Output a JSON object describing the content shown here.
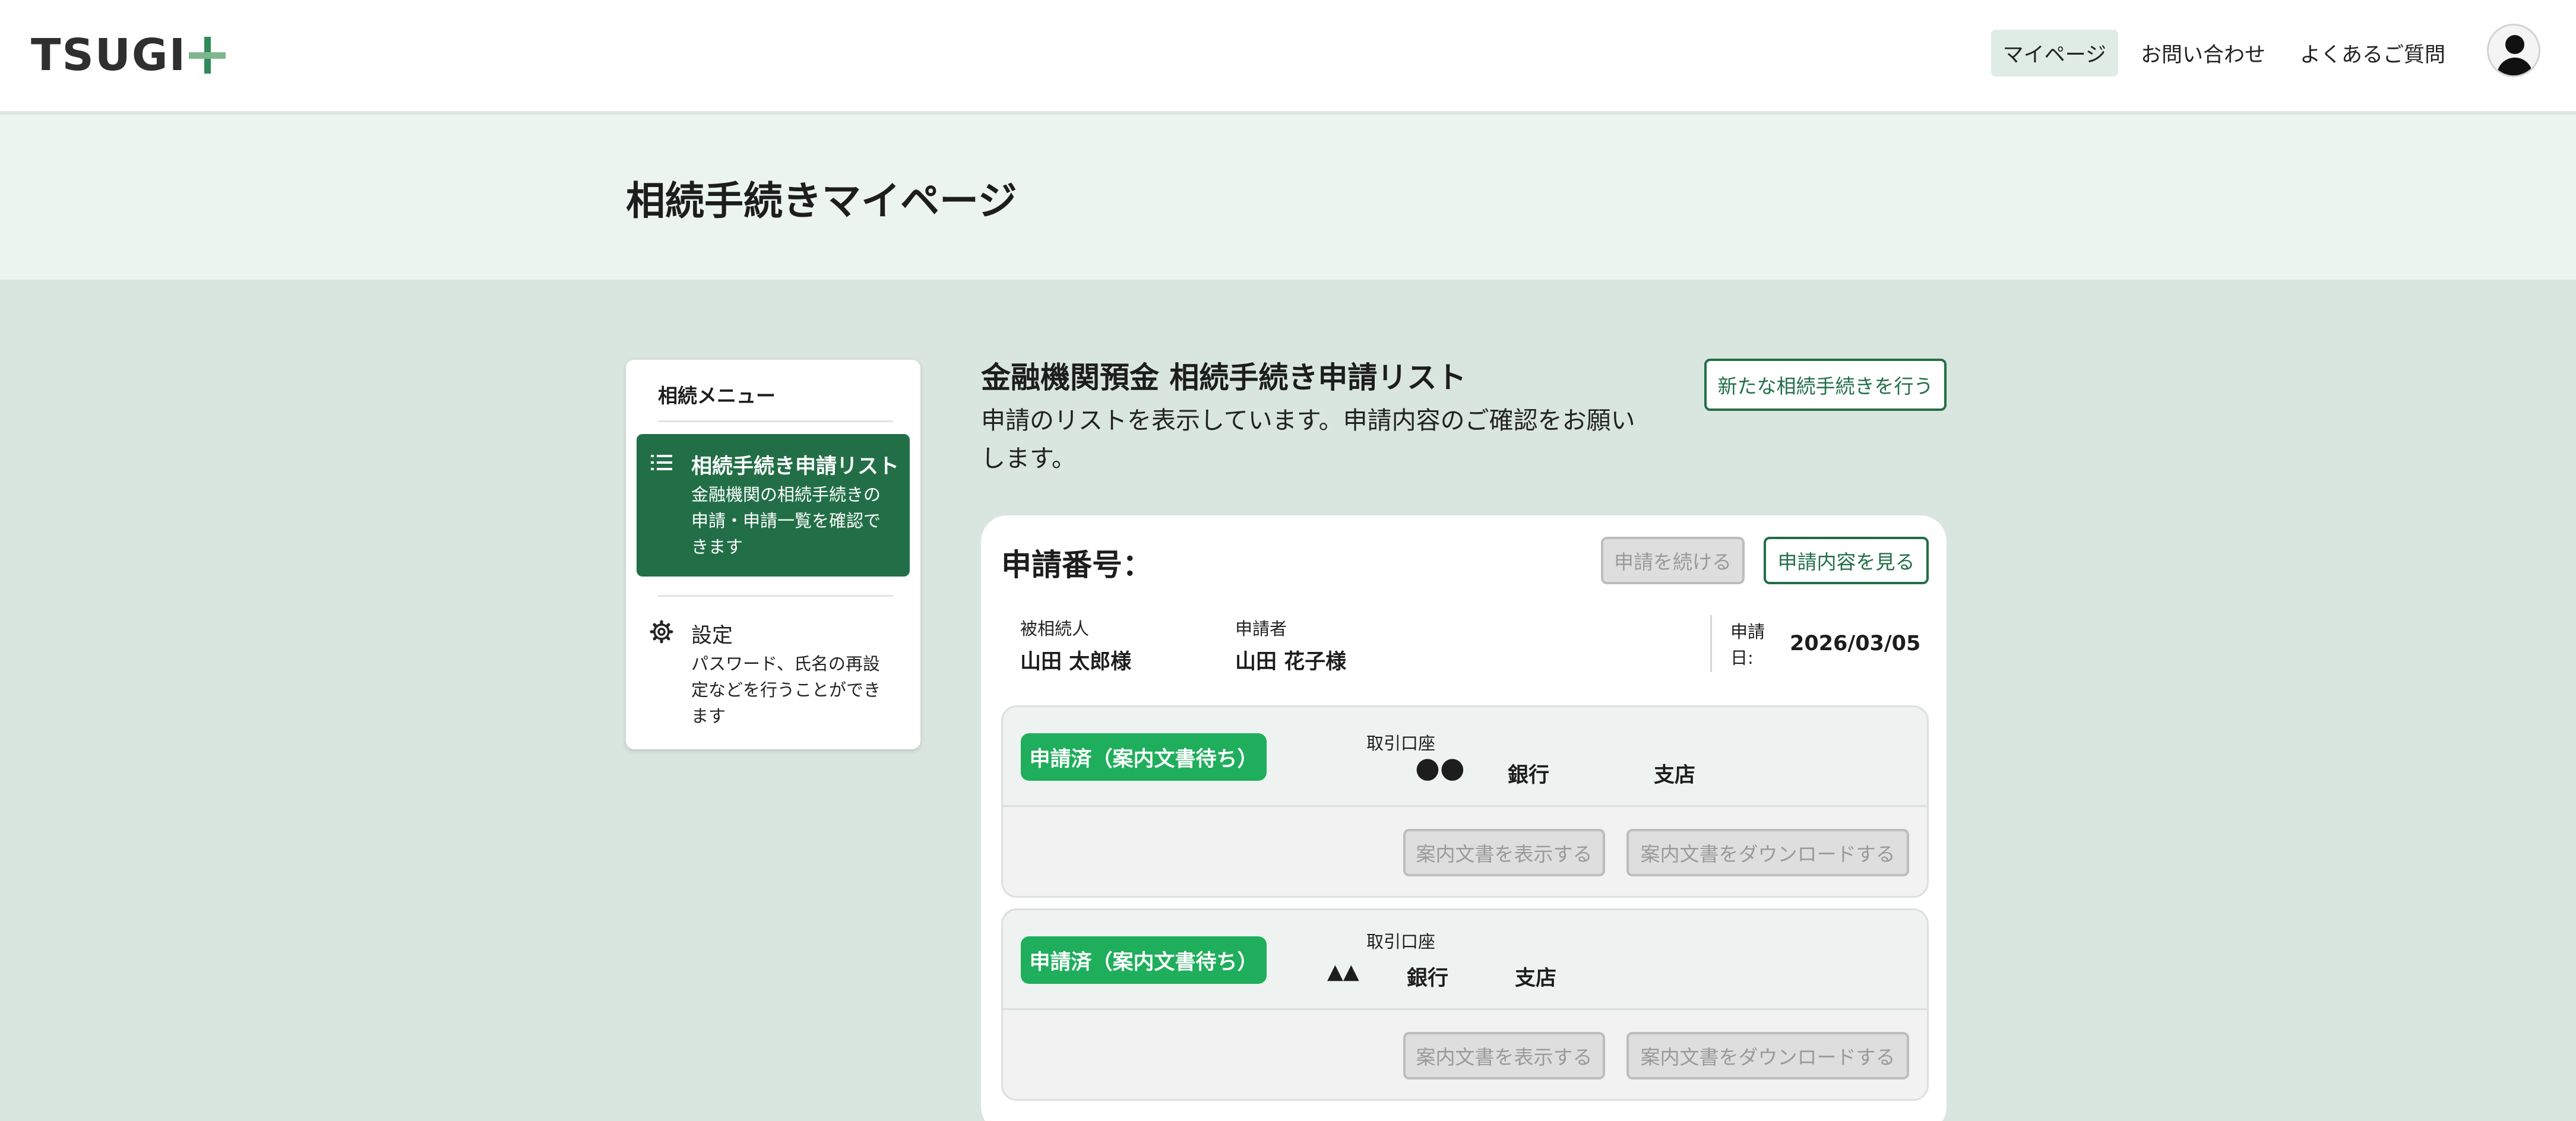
{
  "header": {
    "logo_text": "TSUGI",
    "nav": [
      "マイページ",
      "お問い合わせ",
      "よくあるご質問"
    ],
    "active_nav": "マイページ"
  },
  "page_title": "相続手続きマイページ",
  "sidebar": {
    "heading": "相続メニュー",
    "items": [
      {
        "label": "相続手続き申請リスト",
        "description": "金融機関の相続手続きの申請・申請一覧を確認できます",
        "icon": "list-icon",
        "active": true
      },
      {
        "label": "設定",
        "description": "パスワード、氏名の再設定などを行うことができます",
        "icon": "gear-icon",
        "active": false
      }
    ]
  },
  "main": {
    "title": "金融機関預金 相続手続き申請リスト",
    "description": "申請のリストを表示しています。申請内容のご確認をお願いします。",
    "new_button": "新たな相続手続きを行う"
  },
  "application": {
    "number_label": "申請番号：",
    "continue_button": "申請を続ける",
    "view_button": "申請内容を見る",
    "deceased_label": "被相続人",
    "deceased_name": "山田 太郎様",
    "applicant_label": "申請者",
    "applicant_name": "山田 花子様",
    "date_label": "申請日:",
    "date_value": "2026/03/05",
    "accounts": [
      {
        "status": "申請済（案内文書待ち）",
        "account_label": "取引口座",
        "bank_mark": "●●",
        "bank_suffix": "銀行",
        "branch": "支店",
        "show_doc_button": "案内文書を表示する",
        "download_button": "案内文書をダウンロードする"
      },
      {
        "status": "申請済（案内文書待ち）",
        "account_label": "取引口座",
        "bank_mark": "▲▲",
        "bank_suffix": "銀行",
        "branch": "支店",
        "show_doc_button": "案内文書を表示する",
        "download_button": "案内文書をダウンロードする"
      }
    ]
  },
  "colors": {
    "brand_green": "#226f47",
    "status_green": "#1fae5c",
    "background": "#d9e6df"
  }
}
